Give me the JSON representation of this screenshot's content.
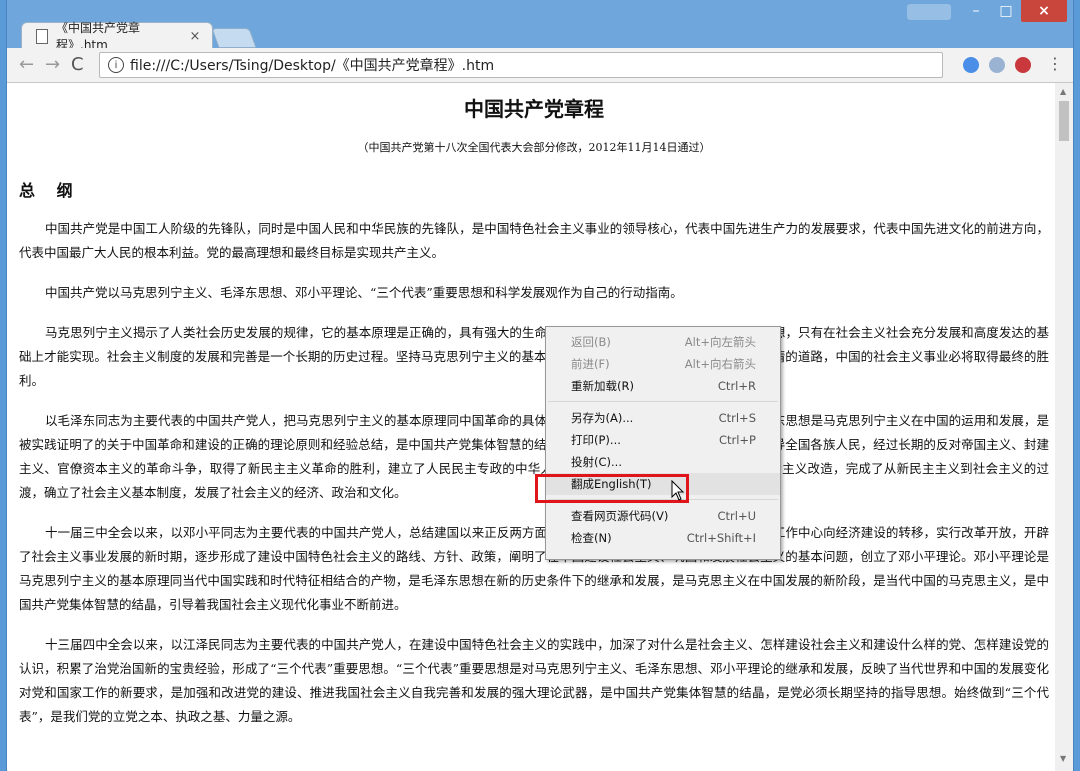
{
  "window": {
    "minimize": "–",
    "maximize": "□",
    "close": "×"
  },
  "tab": {
    "title": "《中国共产党章程》.htm",
    "close": "×"
  },
  "toolbar": {
    "back": "←",
    "forward": "→",
    "reload": "C",
    "address": "file:///C:/Users/Tsing/Desktop/《中国共产党章程》.htm",
    "info": "i",
    "menu": "⋮"
  },
  "document": {
    "title": "中国共产党章程",
    "subtitle": "（中国共产党第十八次全国代表大会部分修改，2012年11月14日通过）",
    "section": "总 纲",
    "paragraphs": [
      "中国共产党是中国工人阶级的先锋队，同时是中国人民和中华民族的先锋队，是中国特色社会主义事业的领导核心，代表中国先进生产力的发展要求，代表中国先进文化的前进方向，代表中国最广大人民的根本利益。党的最高理想和最终目标是实现共产主义。",
      "中国共产党以马克思列宁主义、毛泽东思想、邓小平理论、“三个代表”重要思想和科学发展观作为自己的行动指南。",
      "马克思列宁主义揭示了人类社会历史发展的规律，它的基本原理是正确的，具有强大的生命力。中国共产党人追求的共产主义最高理想，只有在社会主义社会充分发展和高度发达的基础上才能实现。社会主义制度的发展和完善是一个长期的历史过程。坚持马克思列宁主义的基本原理，走中国人民自愿选择的适合中国国情的道路，中国的社会主义事业必将取得最终的胜利。",
      "以毛泽东同志为主要代表的中国共产党人，把马克思列宁主义的基本原理同中国革命的具体实践结合起来，创立了毛泽东思想。毛泽东思想是马克思列宁主义在中国的运用和发展，是被实践证明了的关于中国革命和建设的正确的理论原则和经验总结，是中国共产党集体智慧的结晶。在毛泽东思想指引下，中国共产党领导全国各族人民，经过长期的反对帝国主义、封建主义、官僚资本主义的革命斗争，取得了新民主主义革命的胜利，建立了人民民主专政的中华人民共和国；建国以后，顺利地进行了社会主义改造，完成了从新民主主义到社会主义的过渡，确立了社会主义基本制度，发展了社会主义的经济、政治和文化。",
      "十一届三中全会以来，以邓小平同志为主要代表的中国共产党人，总结建国以来正反两方面的经验，解放思想，实事求是，实现全党工作中心向经济建设的转移，实行改革开放，开辟了社会主义事业发展的新时期，逐步形成了建设中国特色社会主义的路线、方针、政策，阐明了在中国建设社会主义、巩固和发展社会主义的基本问题，创立了邓小平理论。邓小平理论是马克思列宁主义的基本原理同当代中国实践和时代特征相结合的产物，是毛泽东思想在新的历史条件下的继承和发展，是马克思主义在中国发展的新阶段，是当代中国的马克思主义，是中国共产党集体智慧的结晶，引导着我国社会主义现代化事业不断前进。",
      "十三届四中全会以来，以江泽民同志为主要代表的中国共产党人，在建设中国特色社会主义的实践中，加深了对什么是社会主义、怎样建设社会主义和建设什么样的党、怎样建设党的认识，积累了治党治国新的宝贵经验，形成了“三个代表”重要思想。“三个代表”重要思想是对马克思列宁主义、毛泽东思想、邓小平理论的继承和发展，反映了当代世界和中国的发展变化对党和国家工作的新要求，是加强和改进党的建设、推进我国社会主义自我完善和发展的强大理论武器，是中国共产党集体智慧的结晶，是党必须长期坚持的指导思想。始终做到“三个代表”，是我们党的立党之本、执政之基、力量之源。"
    ]
  },
  "context_menu": {
    "groups": [
      [
        {
          "label": "返回(B)",
          "shortcut": "Alt+向左箭头",
          "disabled": true
        },
        {
          "label": "前进(F)",
          "shortcut": "Alt+向右箭头",
          "disabled": true
        },
        {
          "label": "重新加载(R)",
          "shortcut": "Ctrl+R",
          "disabled": false
        }
      ],
      [
        {
          "label": "另存为(A)...",
          "shortcut": "Ctrl+S",
          "disabled": false
        },
        {
          "label": "打印(P)...",
          "shortcut": "Ctrl+P",
          "disabled": false
        },
        {
          "label": "投射(C)...",
          "shortcut": "",
          "disabled": false
        },
        {
          "label": "翻成English(T)",
          "shortcut": "",
          "disabled": false,
          "highlighted": true
        }
      ],
      [
        {
          "label": "查看网页源代码(V)",
          "shortcut": "Ctrl+U",
          "disabled": false
        },
        {
          "label": "检查(N)",
          "shortcut": "Ctrl+Shift+I",
          "disabled": false
        }
      ]
    ]
  },
  "colors": {
    "highlight_border": "#e0141b",
    "close_button": "#c9463d",
    "titlebar": "#6fa7dc"
  }
}
